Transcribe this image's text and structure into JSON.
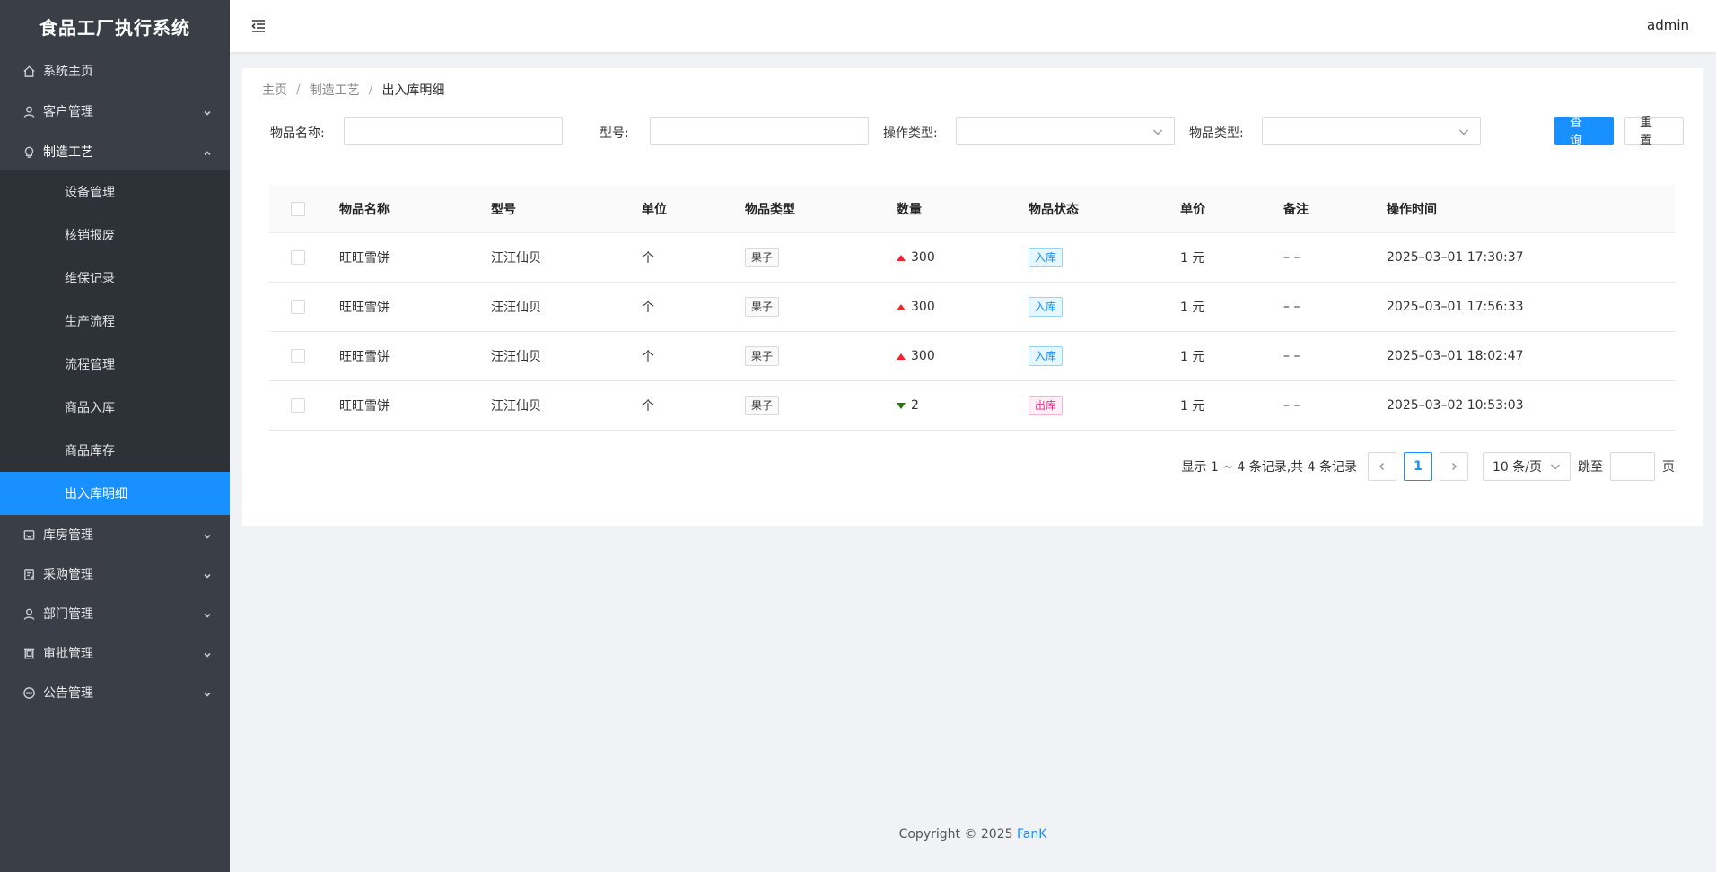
{
  "app": {
    "title": "食品工厂执行系统"
  },
  "sidebar": {
    "items": [
      {
        "label": "系统主页",
        "icon": "home-icon"
      },
      {
        "label": "客户管理",
        "icon": "user-icon"
      },
      {
        "label": "制造工艺",
        "icon": "bulb-icon",
        "children": [
          {
            "label": "设备管理"
          },
          {
            "label": "核销报废"
          },
          {
            "label": "维保记录"
          },
          {
            "label": "生产流程"
          },
          {
            "label": "流程管理"
          },
          {
            "label": "商品入库"
          },
          {
            "label": "商品库存"
          },
          {
            "label": "出入库明细",
            "active": true
          }
        ]
      },
      {
        "label": "库房管理",
        "icon": "inbox-icon"
      },
      {
        "label": "采购管理",
        "icon": "audit-icon"
      },
      {
        "label": "部门管理",
        "icon": "user-icon"
      },
      {
        "label": "审批管理",
        "icon": "frame-icon"
      },
      {
        "label": "公告管理",
        "icon": "message-icon"
      }
    ]
  },
  "header": {
    "user": "admin"
  },
  "breadcrumb": {
    "home": "主页",
    "level2": "制造工艺",
    "current": "出入库明细",
    "sep": "/"
  },
  "form": {
    "name_label": "物品名称:",
    "model_label": "型号:",
    "op_type_label": "操作类型:",
    "item_type_label": "物品类型:",
    "name_value": "",
    "model_value": "",
    "query_button": "查询",
    "reset_button": "重置"
  },
  "table": {
    "columns": [
      "物品名称",
      "型号",
      "单位",
      "物品类型",
      "数量",
      "物品状态",
      "单价",
      "备注",
      "操作时间"
    ],
    "rows": [
      {
        "name": "旺旺雪饼",
        "model": "汪汪仙贝",
        "unit": "个",
        "type": "果子",
        "qty": "300",
        "direction": "up",
        "status": "入库",
        "status_kind": "in",
        "price": "1 元",
        "note": "– –",
        "time": "2025–03–01 17:30:37"
      },
      {
        "name": "旺旺雪饼",
        "model": "汪汪仙贝",
        "unit": "个",
        "type": "果子",
        "qty": "300",
        "direction": "up",
        "status": "入库",
        "status_kind": "in",
        "price": "1 元",
        "note": "– –",
        "time": "2025–03–01 17:56:33"
      },
      {
        "name": "旺旺雪饼",
        "model": "汪汪仙贝",
        "unit": "个",
        "type": "果子",
        "qty": "300",
        "direction": "up",
        "status": "入库",
        "status_kind": "in",
        "price": "1 元",
        "note": "– –",
        "time": "2025–03–01 18:02:47"
      },
      {
        "name": "旺旺雪饼",
        "model": "汪汪仙贝",
        "unit": "个",
        "type": "果子",
        "qty": "2",
        "direction": "down",
        "status": "出库",
        "status_kind": "out",
        "price": "1 元",
        "note": "– –",
        "time": "2025–03–02 10:53:03"
      }
    ]
  },
  "pagination": {
    "total_text": "显示 1 ~ 4 条记录,共 4 条记录",
    "current_page": "1",
    "page_size": "10 条/页",
    "jump_label": "跳至",
    "jump_suffix": "页",
    "jump_value": ""
  },
  "footer": {
    "text": "Copyright © 2025 ",
    "brand": "FanK"
  },
  "colors": {
    "primary": "#1890ff",
    "sidebar_bg": "#3a3f47",
    "submenu_bg": "#2d3238",
    "in_tag": "#1890ff",
    "out_tag": "#eb2f96",
    "up_arrow": "#f5222d",
    "down_arrow": "#237804"
  }
}
